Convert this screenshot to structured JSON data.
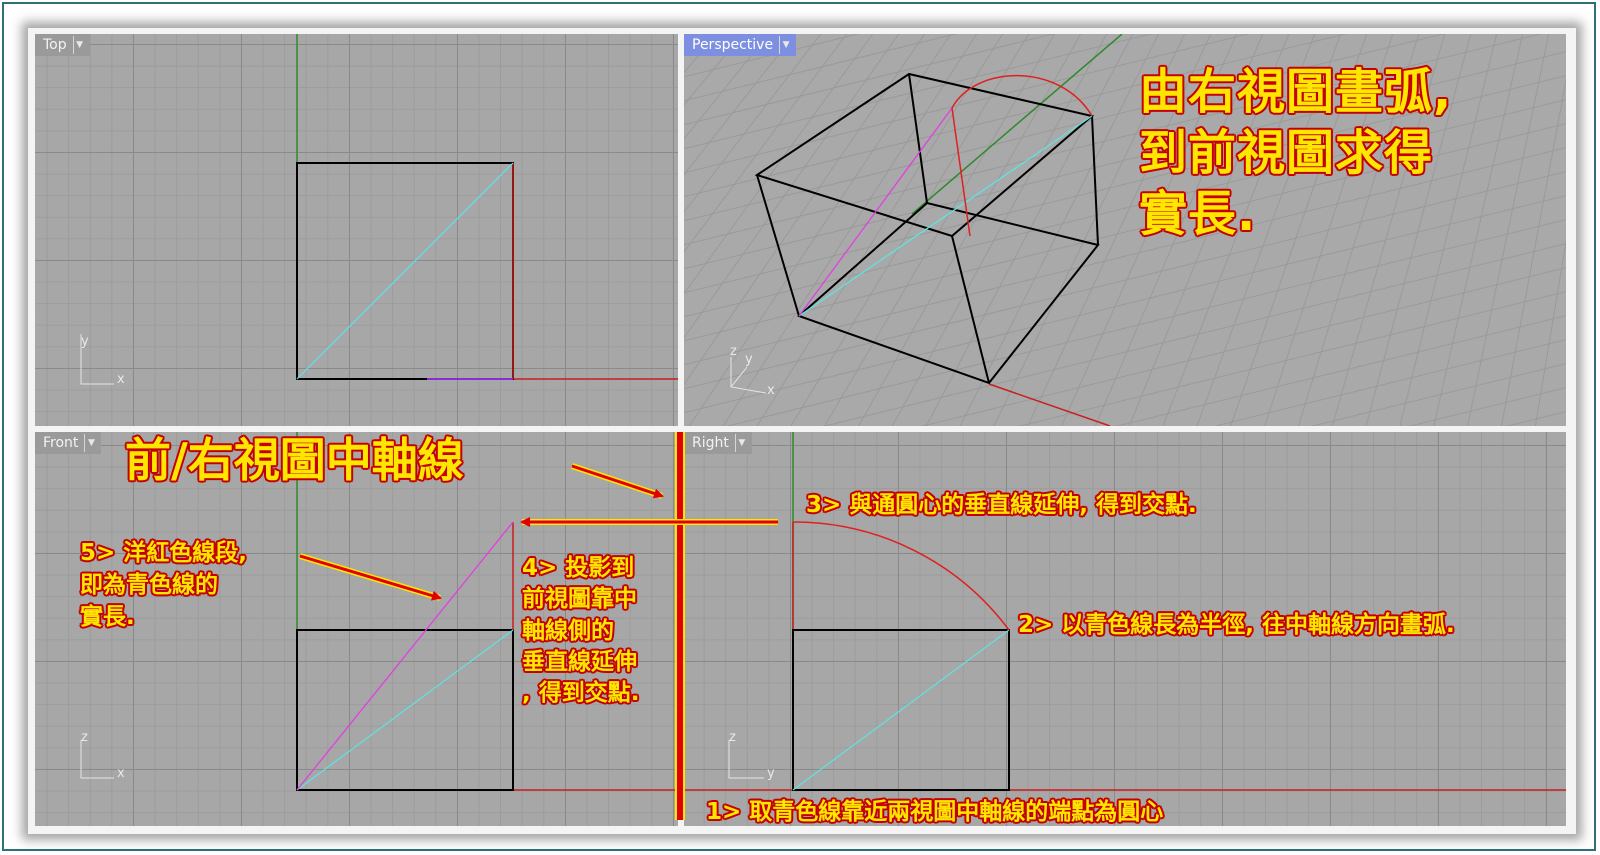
{
  "viewports": {
    "top": {
      "label": "Top",
      "axis_x": "x",
      "axis_y": "y"
    },
    "perspective": {
      "label": "Perspective",
      "axis_x": "x",
      "axis_y": "y",
      "axis_z": "z"
    },
    "front": {
      "label": "Front",
      "axis_x": "x",
      "axis_z": "z"
    },
    "right": {
      "label": "Right",
      "axis_y": "y",
      "axis_z": "z"
    }
  },
  "annotations": {
    "title_lines": [
      "由右視圖畫弧,",
      "到前視圖求得",
      "實長."
    ],
    "center_axis_label": "前/右視圖中軸線",
    "step1": "1> 取青色線靠近兩視圖中軸線的端點為圓心",
    "step2": "2> 以青色線長為半徑, 往中軸線方向畫弧.",
    "step3": "3> 與通圓心的垂直線延伸, 得到交點.",
    "step4_lines": [
      "4> 投影到",
      "前視圖靠中",
      "軸線側的",
      "垂直線延伸",
      ", 得到交點."
    ],
    "step5_lines": [
      "5> 洋紅色線段,",
      "即為青色線的",
      "實長."
    ]
  },
  "colors": {
    "note_fill": "#ffe600",
    "note_outline": "#c40000",
    "cyan_line": "#5fe3e3",
    "magenta_line": "#e040e0",
    "red_axis": "#c81e1e",
    "green_axis": "#2f8a2f",
    "edge": "#000000",
    "perspective_tab": "#7d8fe0"
  },
  "icons": {
    "dropdown": "chevron-down-icon"
  }
}
